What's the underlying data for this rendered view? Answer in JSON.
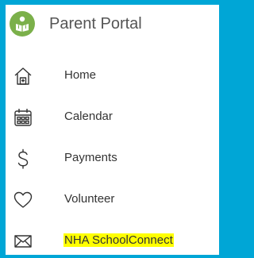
{
  "app": {
    "title": "Parent Portal",
    "logo_icon": "reading-child-icon",
    "logo_color": "#7bb04a",
    "background_color": "#00a6d6"
  },
  "nav": {
    "items": [
      {
        "label": "Home",
        "icon": "home-icon"
      },
      {
        "label": "Calendar",
        "icon": "calendar-icon"
      },
      {
        "label": "Payments",
        "icon": "dollar-icon"
      },
      {
        "label": "Volunteer",
        "icon": "heart-icon"
      },
      {
        "label": "NHA SchoolConnect",
        "icon": "envelope-icon",
        "highlight_color": "#ffff00"
      }
    ]
  }
}
